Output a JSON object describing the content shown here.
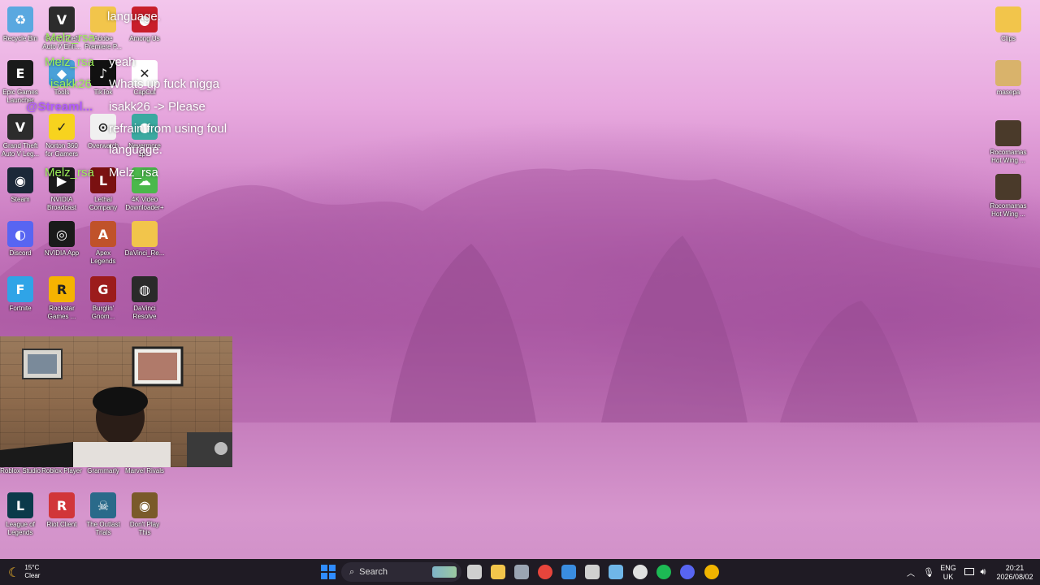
{
  "desktop": {
    "icons": [
      {
        "label": "Recycle Bin",
        "icon": "recycle-bin-icon",
        "color": "#5aa8e0",
        "glyph": "♻"
      },
      {
        "label": "Grand Theft Auto V Enh...",
        "icon": "gta-icon",
        "color": "#2c2c2c",
        "glyph": "V"
      },
      {
        "label": "Adobe Premiere P...",
        "icon": "folder-icon",
        "color": "#f2c54b",
        "glyph": ""
      },
      {
        "label": "Among Us",
        "icon": "among-us-icon",
        "color": "#c81e2a",
        "glyph": "●"
      },
      {
        "label": "Epic Games Launcher",
        "icon": "epic-games-icon",
        "color": "#1a1a1a",
        "glyph": "E"
      },
      {
        "label": "Tools",
        "icon": "tools-icon",
        "color": "#4aa0d8",
        "glyph": "◆"
      },
      {
        "label": "TikTok",
        "icon": "tiktok-icon",
        "color": "#111111",
        "glyph": "♪"
      },
      {
        "label": "CapCut",
        "icon": "capcut-icon",
        "color": "#ffffff",
        "glyph": "✕"
      },
      {
        "label": "Grand Theft Auto V Leg...",
        "icon": "gta-legacy-icon",
        "color": "#2c2c2c",
        "glyph": "V"
      },
      {
        "label": "Norton 360 for Gamers",
        "icon": "norton-icon",
        "color": "#f7d31e",
        "glyph": "✓"
      },
      {
        "label": "Overwatch",
        "icon": "overwatch-icon",
        "color": "#f0f0f0",
        "glyph": "⊙"
      },
      {
        "label": "Nevermore 1p...",
        "icon": "nevermore-icon",
        "color": "#3aa9a0",
        "glyph": "●"
      },
      {
        "label": "Steam",
        "icon": "steam-icon",
        "color": "#1b2838",
        "glyph": "◉"
      },
      {
        "label": "NVIDIA Broadcast",
        "icon": "nvidia-broadcast-icon",
        "color": "#1a1a1a",
        "glyph": "▶"
      },
      {
        "label": "Lethal Company",
        "icon": "lethal-company-icon",
        "color": "#7a1111",
        "glyph": "L"
      },
      {
        "label": "4K Video Downloader+",
        "icon": "4k-downloader-icon",
        "color": "#4bb84b",
        "glyph": "☁"
      },
      {
        "label": "Discord",
        "icon": "discord-icon",
        "color": "#5865f2",
        "glyph": "◐"
      },
      {
        "label": "NVIDIA App",
        "icon": "nvidia-app-icon",
        "color": "#1a1a1a",
        "glyph": "◎"
      },
      {
        "label": "Apex Legends",
        "icon": "apex-legends-icon",
        "color": "#c0522a",
        "glyph": "A"
      },
      {
        "label": "DaVinci_Re...",
        "icon": "folder-icon",
        "color": "#f2c54b",
        "glyph": ""
      },
      {
        "label": "Fortnite",
        "icon": "fortnite-icon",
        "color": "#2fa4e7",
        "glyph": "F"
      },
      {
        "label": "Rockstar Games ...",
        "icon": "rockstar-icon",
        "color": "#f5b301",
        "glyph": "R"
      },
      {
        "label": "Burglin' Gnom...",
        "icon": "burglin-gnomes-icon",
        "color": "#9c1c1c",
        "glyph": "G"
      },
      {
        "label": "DaVinci Resolve",
        "icon": "davinci-resolve-icon",
        "color": "#2a2a2a",
        "glyph": "◍"
      },
      {
        "label": "Roblox Studio",
        "icon": "roblox-studio-icon",
        "color": "#3a7bd5",
        "glyph": "■"
      },
      {
        "label": "Roblox Player",
        "icon": "roblox-player-icon",
        "color": "#222222",
        "glyph": "■"
      },
      {
        "label": "Grammarly",
        "icon": "grammarly-icon",
        "color": "#15c39a",
        "glyph": "G"
      },
      {
        "label": "Marvel Rivals",
        "icon": "marvel-rivals-icon",
        "color": "#f0c020",
        "glyph": "M"
      },
      {
        "label": "League of Legends",
        "icon": "league-of-legends-icon",
        "color": "#0b3a4a",
        "glyph": "L"
      },
      {
        "label": "Riot Client",
        "icon": "riot-client-icon",
        "color": "#d13639",
        "glyph": "R"
      },
      {
        "label": "The Outlast Trials",
        "icon": "outlast-trials-icon",
        "color": "#2a6a8a",
        "glyph": "☠"
      },
      {
        "label": "Don't Play This",
        "icon": "dont-play-this-icon",
        "color": "#7a5a2a",
        "glyph": "◉"
      }
    ],
    "right_icons": [
      {
        "label": "Clips",
        "icon": "folder-icon",
        "color": "#f2c54b"
      },
      {
        "label": "masepa",
        "icon": "image-file-icon",
        "color": "#d9b36b"
      },
      {
        "label": "Rocomamas Hot Wing ...",
        "icon": "video-file-icon",
        "color": "#4a3a2a"
      },
      {
        "label": "Rocomamas Hot Wing ...",
        "icon": "video-file-icon",
        "color": "#4a3a2a"
      }
    ]
  },
  "chat": {
    "lines": [
      {
        "text": "language.",
        "style": "white"
      },
      {
        "text": "Melz_rsa",
        "style": "green"
      },
      {
        "text": "Melz_rsa",
        "style": "green"
      },
      {
        "text": "yeah",
        "style": "white"
      },
      {
        "text": "isakk26",
        "style": "green"
      },
      {
        "text": "Whats up fuck nigga",
        "style": "white"
      },
      {
        "text": "@Streaml...",
        "style": "purple"
      },
      {
        "text": "isakk26 -> Please",
        "style": "white"
      },
      {
        "text": "refrain from using foul",
        "style": "white"
      },
      {
        "text": "language.",
        "style": "white"
      },
      {
        "text": "Melz_rsa",
        "style": "green"
      },
      {
        "text": "Melz_rsa",
        "style": "white"
      }
    ]
  },
  "taskbar": {
    "weather": {
      "temp": "15°C",
      "condition": "Clear"
    },
    "search_label": "Search",
    "apps": [
      {
        "icon": "windows-start-icon",
        "color": "#2f8cff"
      },
      {
        "icon": "task-view-icon",
        "color": "#cfcfcf"
      },
      {
        "icon": "file-explorer-icon",
        "color": "#f2c54b"
      },
      {
        "icon": "settings-icon",
        "color": "#9aa4b2"
      },
      {
        "icon": "chrome-icon",
        "color": "#e8453c"
      },
      {
        "icon": "microsoft-store-icon",
        "color": "#3a8de0"
      },
      {
        "icon": "controller-icon",
        "color": "#d0d0d0"
      },
      {
        "icon": "steam-icon",
        "color": "#6fb6e8"
      },
      {
        "icon": "overwatch-icon",
        "color": "#e0e0e0"
      },
      {
        "icon": "spotify-icon",
        "color": "#1db954"
      },
      {
        "icon": "discord-icon",
        "color": "#5865f2"
      },
      {
        "icon": "chrome-icon",
        "color": "#f0b400"
      }
    ],
    "tray": {
      "language": "ENG",
      "region": "UK",
      "time": "20:21",
      "date": "2026/08/02"
    }
  }
}
